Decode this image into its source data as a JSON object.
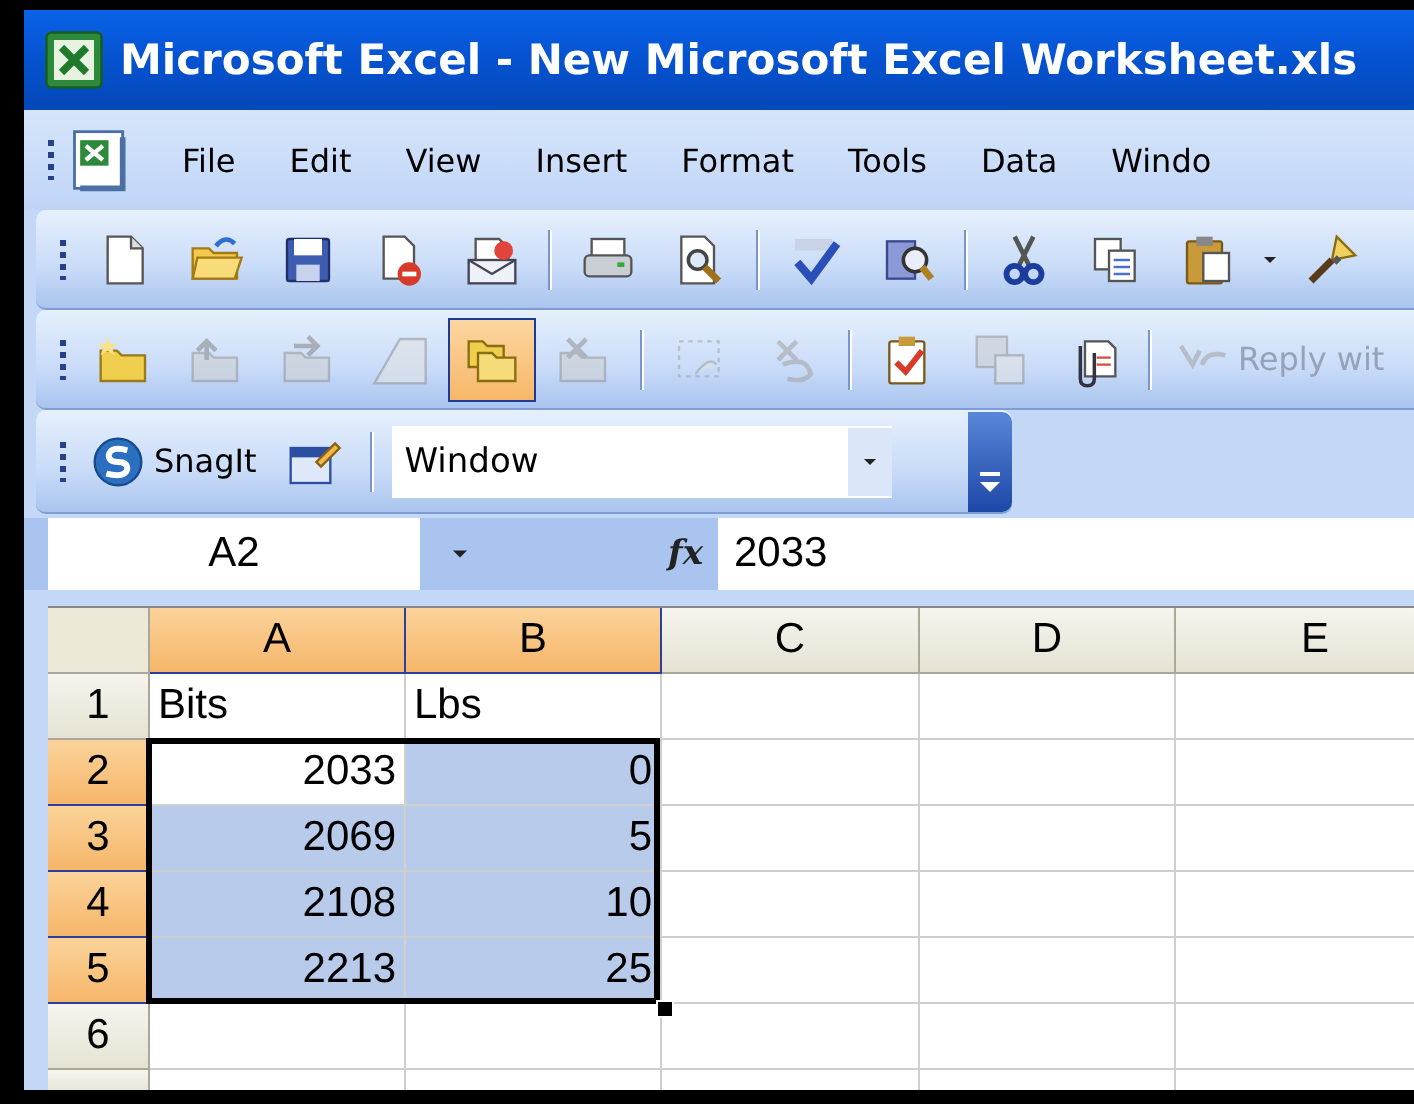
{
  "window": {
    "title": "Microsoft Excel - New Microsoft Excel Worksheet.xls"
  },
  "menu_bar": {
    "items": [
      {
        "label": "File"
      },
      {
        "label": "Edit"
      },
      {
        "label": "View"
      },
      {
        "label": "Insert"
      },
      {
        "label": "Format"
      },
      {
        "label": "Tools"
      },
      {
        "label": "Data"
      },
      {
        "label": "Windo"
      }
    ]
  },
  "toolbars": [
    {
      "items": [
        {
          "kind": "button",
          "disabled": false,
          "pressed": false
        },
        {
          "kind": "button",
          "disabled": false,
          "pressed": false
        },
        {
          "kind": "button",
          "disabled": false,
          "pressed": false
        },
        {
          "kind": "button",
          "disabled": false,
          "pressed": false
        },
        {
          "kind": "button",
          "disabled": false,
          "pressed": false
        },
        {
          "kind": "separator"
        },
        {
          "kind": "button",
          "disabled": false,
          "pressed": false
        },
        {
          "kind": "button",
          "disabled": false,
          "pressed": false
        },
        {
          "kind": "separator"
        },
        {
          "kind": "button",
          "disabled": false,
          "pressed": false
        },
        {
          "kind": "button",
          "disabled": false,
          "pressed": false
        },
        {
          "kind": "separator"
        },
        {
          "kind": "button",
          "disabled": false,
          "pressed": false
        },
        {
          "kind": "button",
          "disabled": false,
          "pressed": false
        },
        {
          "kind": "button",
          "disabled": false,
          "pressed": false
        },
        {
          "kind": "arrow"
        },
        {
          "kind": "button",
          "disabled": false,
          "pressed": false
        }
      ]
    },
    {
      "items": [
        {
          "kind": "button",
          "disabled": false,
          "pressed": false
        },
        {
          "kind": "button",
          "disabled": true,
          "pressed": false
        },
        {
          "kind": "button",
          "disabled": true,
          "pressed": false
        },
        {
          "kind": "button",
          "disabled": true,
          "pressed": false
        },
        {
          "kind": "button",
          "disabled": false,
          "pressed": true
        },
        {
          "kind": "button",
          "disabled": true,
          "pressed": false
        },
        {
          "kind": "separator"
        },
        {
          "kind": "button",
          "disabled": true,
          "pressed": false
        },
        {
          "kind": "button",
          "disabled": true,
          "pressed": false
        },
        {
          "kind": "separator"
        },
        {
          "kind": "button",
          "disabled": false,
          "pressed": false
        },
        {
          "kind": "button",
          "disabled": true,
          "pressed": false
        },
        {
          "kind": "button",
          "disabled": false,
          "pressed": false
        },
        {
          "kind": "separator"
        },
        {
          "kind": "text-button",
          "label": "Reply wit",
          "disabled": true
        }
      ]
    },
    {
      "items": [
        {
          "kind": "text-button",
          "label": "SnagIt",
          "disabled": false
        },
        {
          "kind": "button",
          "disabled": false,
          "pressed": false
        },
        {
          "kind": "separator"
        },
        {
          "kind": "combo",
          "value": "Window"
        },
        {
          "kind": "chevron"
        }
      ]
    }
  ],
  "formula_bar": {
    "name_box": "A2",
    "function_label": "fx",
    "formula": "2033"
  },
  "sheet": {
    "columns": [
      {
        "label": "A",
        "selected": true
      },
      {
        "label": "B",
        "selected": true
      },
      {
        "label": "C",
        "selected": false
      },
      {
        "label": "D",
        "selected": false
      },
      {
        "label": "E",
        "selected": false
      }
    ],
    "rows": [
      {
        "label": "1",
        "selected": false,
        "cells": [
          {
            "value": "Bits",
            "kind": "text",
            "selected": false,
            "active": false
          },
          {
            "value": "Lbs",
            "kind": "text",
            "selected": false,
            "active": false
          }
        ]
      },
      {
        "label": "2",
        "selected": true,
        "cells": [
          {
            "value": "2033",
            "kind": "number",
            "selected": true,
            "active": true
          },
          {
            "value": "0",
            "kind": "number",
            "selected": true,
            "active": false
          }
        ]
      },
      {
        "label": "3",
        "selected": true,
        "cells": [
          {
            "value": "2069",
            "kind": "number",
            "selected": true,
            "active": false
          },
          {
            "value": "5",
            "kind": "number",
            "selected": true,
            "active": false
          }
        ]
      },
      {
        "label": "4",
        "selected": true,
        "cells": [
          {
            "value": "2108",
            "kind": "number",
            "selected": true,
            "active": false
          },
          {
            "value": "10",
            "kind": "number",
            "selected": true,
            "active": false
          }
        ]
      },
      {
        "label": "5",
        "selected": true,
        "cells": [
          {
            "value": "2213",
            "kind": "number",
            "selected": true,
            "active": false
          },
          {
            "value": "25",
            "kind": "number",
            "selected": true,
            "active": false
          }
        ]
      },
      {
        "label": "6",
        "selected": false
      }
    ]
  }
}
